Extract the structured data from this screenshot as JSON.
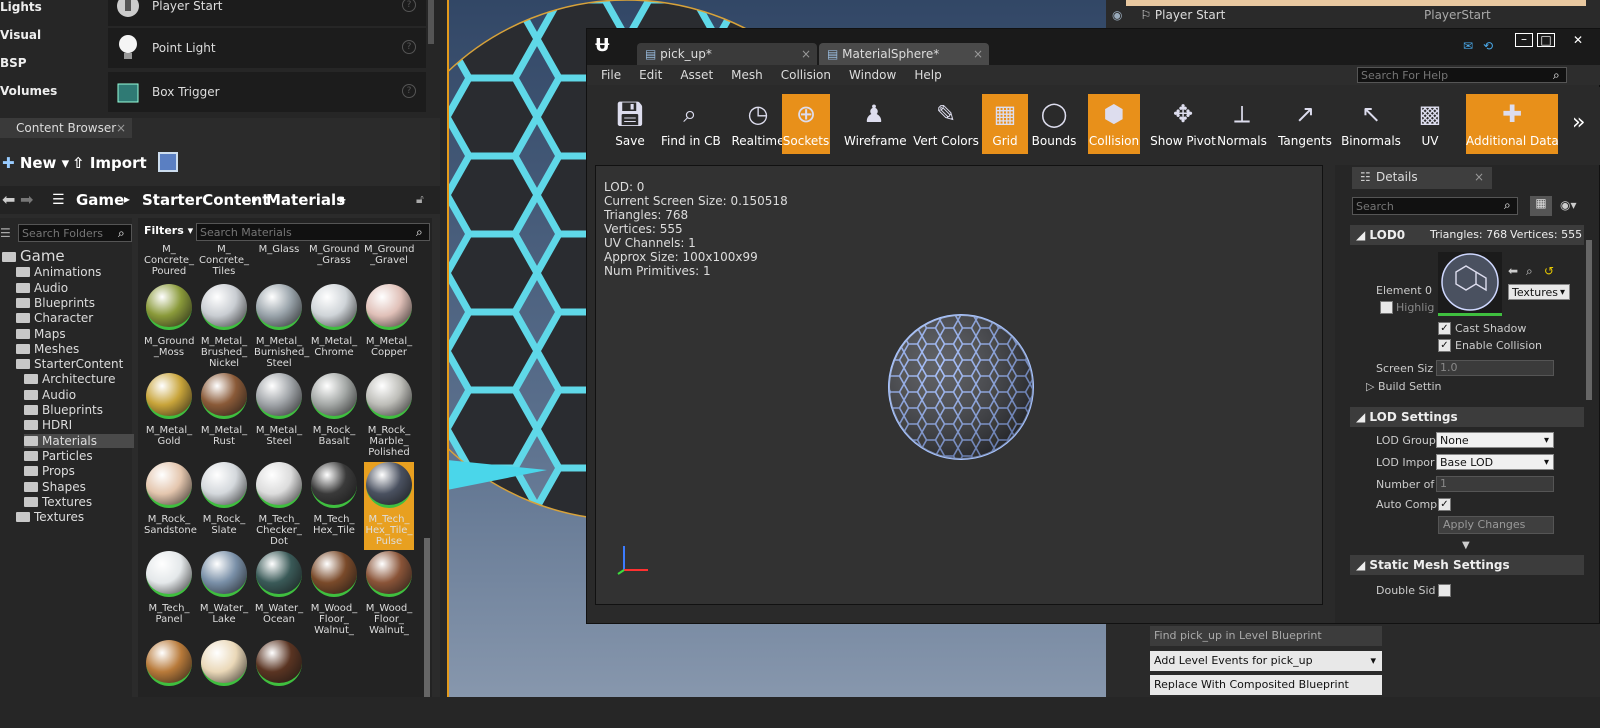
{
  "modes": {
    "categories": [
      "Lights",
      "Visual",
      "BSP",
      "Volumes"
    ],
    "items": [
      {
        "label": "Player Start",
        "icon": "player-start-icon"
      },
      {
        "label": "Point Light",
        "icon": "point-light-icon"
      },
      {
        "label": "Box Trigger",
        "icon": "box-trigger-icon"
      }
    ]
  },
  "content_browser": {
    "tab_title": "Content Browser",
    "new_label": "New",
    "import_label": "Import",
    "breadcrumb": [
      "Game",
      "StarterContent",
      "Materials"
    ],
    "search_folders_placeholder": "Search Folders",
    "filters_label": "Filters",
    "search_assets_placeholder": "Search Materials",
    "folders": [
      {
        "label": "Game",
        "depth": 0
      },
      {
        "label": "Animations",
        "depth": 1
      },
      {
        "label": "Audio",
        "depth": 1
      },
      {
        "label": "Blueprints",
        "depth": 1
      },
      {
        "label": "Character",
        "depth": 1
      },
      {
        "label": "Maps",
        "depth": 1
      },
      {
        "label": "Meshes",
        "depth": 1
      },
      {
        "label": "StarterContent",
        "depth": 1
      },
      {
        "label": "Architecture",
        "depth": 2
      },
      {
        "label": "Audio",
        "depth": 2
      },
      {
        "label": "Blueprints",
        "depth": 2
      },
      {
        "label": "HDRI",
        "depth": 2
      },
      {
        "label": "Materials",
        "depth": 2
      },
      {
        "label": "Particles",
        "depth": 2
      },
      {
        "label": "Props",
        "depth": 2
      },
      {
        "label": "Shapes",
        "depth": 2
      },
      {
        "label": "Textures",
        "depth": 2
      },
      {
        "label": "Textures",
        "depth": 1
      }
    ],
    "top_row": [
      "M_\nConcrete_\nPoured",
      "M_\nConcrete_\nTiles",
      "M_Glass",
      "M_Ground\n_Grass",
      "M_Ground\n_Gravel"
    ],
    "materials": [
      {
        "label": "M_Ground\n_Moss",
        "color": "#8a9a3a"
      },
      {
        "label": "M_Metal_\nBrushed_\nNickel",
        "color": "#c9cdd2"
      },
      {
        "label": "M_Metal_\nBurnished_\nSteel",
        "color": "#9aa4ab"
      },
      {
        "label": "M_Metal_\nChrome",
        "color": "#cfd4d8"
      },
      {
        "label": "M_Metal_\nCopper",
        "color": "#e0c0b8"
      },
      {
        "label": "M_Metal_\nGold",
        "color": "#c8a43a"
      },
      {
        "label": "M_Metal_\nRust",
        "color": "#8a5a38"
      },
      {
        "label": "M_Metal_\nSteel",
        "color": "#a0a4a8"
      },
      {
        "label": "M_Rock_\nBasalt",
        "color": "#a4a8a6"
      },
      {
        "label": "M_Rock_\nMarble_\nPolished",
        "color": "#bdbdb8"
      },
      {
        "label": "M_Rock_\nSandstone",
        "color": "#e4c6ae"
      },
      {
        "label": "M_Rock_\nSlate",
        "color": "#d4d8dc"
      },
      {
        "label": "M_Tech_\nChecker_\nDot",
        "color": "#dcdcdc"
      },
      {
        "label": "M_Tech_\nHex_Tile",
        "color": "#3a3a3a"
      },
      {
        "label": "M_Tech_\nHex_Tile_\nPulse",
        "color": "#4a5160"
      },
      {
        "label": "M_Tech_\nPanel",
        "color": "#e4e8ea"
      },
      {
        "label": "M_Water_\nLake",
        "color": "#7a90a8"
      },
      {
        "label": "M_Water_\nOcean",
        "color": "#3a5a58"
      },
      {
        "label": "M_Wood_\nFloor_\nWalnut_",
        "color": "#7a4a2a"
      },
      {
        "label": "M_Wood_\nFloor_\nWalnut_",
        "color": "#8a5438"
      },
      {
        "label": "",
        "color": "#b87a3a"
      },
      {
        "label": "",
        "color": "#ead8b8"
      },
      {
        "label": "",
        "color": "#5a3422"
      }
    ],
    "selected_material_index": 14
  },
  "editor": {
    "tabs": [
      "pick_up*",
      "MaterialSphere*"
    ],
    "menu": [
      "File",
      "Edit",
      "Asset",
      "Mesh",
      "Collision",
      "Window",
      "Help"
    ],
    "help_search_placeholder": "Search For Help",
    "toolbar": [
      {
        "label": "Save",
        "icon": "save-icon",
        "active": false
      },
      {
        "label": "Find in CB",
        "icon": "find-in-cb-icon",
        "active": false
      },
      {
        "label": "Realtime",
        "icon": "realtime-icon",
        "active": false
      },
      {
        "label": "Sockets",
        "icon": "sockets-icon",
        "active": true
      },
      {
        "label": "Wireframe",
        "icon": "wireframe-icon",
        "active": false
      },
      {
        "label": "Vert Colors",
        "icon": "vert-colors-icon",
        "active": false
      },
      {
        "label": "Grid",
        "icon": "grid-icon",
        "active": true
      },
      {
        "label": "Bounds",
        "icon": "bounds-icon",
        "active": false
      },
      {
        "label": "Collision",
        "icon": "collision-icon",
        "active": true
      },
      {
        "label": "Show Pivot",
        "icon": "show-pivot-icon",
        "active": false
      },
      {
        "label": "Normals",
        "icon": "normals-icon",
        "active": false
      },
      {
        "label": "Tangents",
        "icon": "tangents-icon",
        "active": false
      },
      {
        "label": "Binormals",
        "icon": "binormals-icon",
        "active": false
      },
      {
        "label": "UV",
        "icon": "uv-icon",
        "active": false
      },
      {
        "label": "Additional Data",
        "icon": "additional-data-icon",
        "active": true
      }
    ],
    "stats": [
      "LOD:  0",
      "Current Screen Size:  0.150518",
      "Triangles:  768",
      "Vertices:  555",
      "UV Channels:  1",
      "Approx Size:  100x100x99",
      "Num Primitives:  1"
    ]
  },
  "details": {
    "tab_title": "Details",
    "search_placeholder": "Search",
    "lod0": {
      "title": "LOD0",
      "triangles": "Triangles: 768",
      "vertices": "Vertices: 555",
      "element_label": "Element 0",
      "highlight_label": "Highlig",
      "textures_label": "Textures",
      "cast_shadow": "Cast Shadow",
      "enable_collision": "Enable Collision",
      "screen_size_label": "Screen Siz",
      "screen_size_value": "1.0",
      "build_settings": "Build Settin"
    },
    "lod_settings": {
      "title": "LOD Settings",
      "lod_group_label": "LOD Group",
      "lod_group_value": "None",
      "lod_import_label": "LOD Impor",
      "lod_import_value": "Base LOD",
      "number_of_label": "Number of",
      "number_of_value": "1",
      "auto_comp_label": "Auto Comp",
      "apply_changes": "Apply Changes"
    },
    "static_mesh": {
      "title": "Static Mesh Settings",
      "double_sided_label": "Double Sid"
    }
  },
  "outliner": {
    "row_label": "Player Start",
    "row_type": "PlayerStart",
    "top_label": "pick_up"
  },
  "actor_buttons": [
    "Find pick_up in Level Blueprint",
    "Add Level Events for pick_up",
    "Replace With Composited Blueprint"
  ]
}
